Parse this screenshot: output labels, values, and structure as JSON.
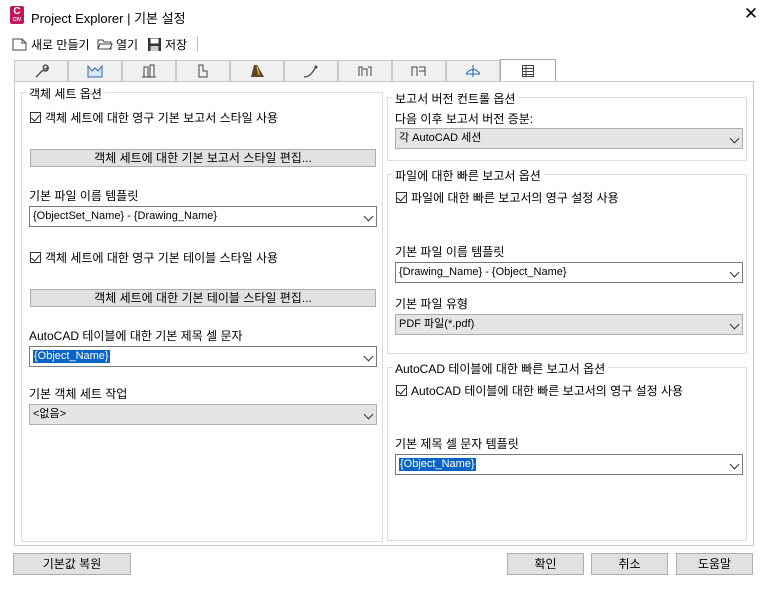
{
  "window": {
    "title": "Project Explorer | 기본 설정",
    "logo_letter": "C",
    "logo_sub": "CIV",
    "close_symbol": "✕"
  },
  "toolbar": {
    "new_label": "새로 만들기",
    "open_label": "열기",
    "save_label": "저장"
  },
  "tabs": [
    {
      "icon": "wrench-icon"
    },
    {
      "icon": "surface-icon"
    },
    {
      "icon": "structure-icon"
    },
    {
      "icon": "pipe-icon"
    },
    {
      "icon": "road-icon"
    },
    {
      "icon": "alignment-icon"
    },
    {
      "icon": "assembly-icon"
    },
    {
      "icon": "corridor-icon"
    },
    {
      "icon": "profile-icon"
    },
    {
      "icon": "table-icon",
      "active": true
    }
  ],
  "left": {
    "group_title": "객체 세트 옵션",
    "chk_report_style": "객체 세트에 대한 영구 기본 보고서 스타일 사용",
    "btn_edit_report_style": "객체 세트에 대한 기본 보고서 스타일 편집...",
    "filename_label": "기본 파일 이름 템플릿",
    "filename_value": "{ObjectSet_Name} - {Drawing_Name}",
    "chk_table_style": "객체 세트에 대한 영구 기본 테이블 스타일 사용",
    "btn_edit_table_style": "객체 세트에 대한 기본 테이블 스타일 편집...",
    "title_cell_label": "AutoCAD 테이블에 대한 기본 제목 셀 문자",
    "title_cell_value": "{Object_Name}",
    "default_task_label": "기본 객체 세트 작업",
    "default_task_value": "<없음>"
  },
  "right": {
    "version_group": "보고서 버전 컨트롤 옵션",
    "version_label": "다음 이후 보고서 버전 증분:",
    "version_value": "각 AutoCAD 세션",
    "quick_group": "파일에 대한 빠른 보고서 옵션",
    "chk_quick_file": "파일에 대한 빠른 보고서의 영구 설정 사용",
    "quick_filename_label": "기본 파일 이름 템플릿",
    "quick_filename_value": "{Drawing_Name} - {Object_Name}",
    "filetype_label": "기본 파일 유형",
    "filetype_value": "PDF 파일(*.pdf)",
    "table_group": "AutoCAD 테이블에 대한 빠른 보고서 옵션",
    "chk_quick_table": "AutoCAD 테이블에 대한 빠른 보고서의 영구 설정 사용",
    "title_template_label": "기본 제목 셀 문자 템플릿",
    "title_template_value": "{Object_Name}"
  },
  "footer": {
    "restore_label": "기본값 복원",
    "ok_label": "확인",
    "cancel_label": "취소",
    "help_label": "도움말"
  },
  "colors": {
    "logo": "#c2185b",
    "selection": "#0a64c8"
  }
}
